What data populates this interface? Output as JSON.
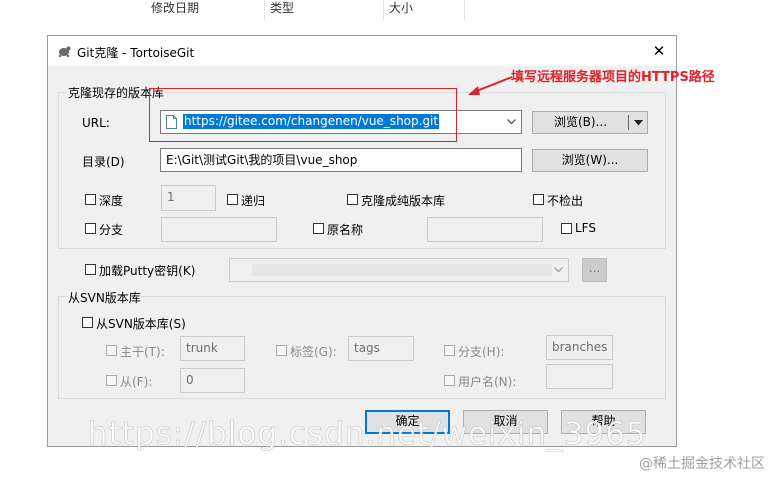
{
  "background": {
    "columns": [
      "修改日期",
      "类型",
      "大小"
    ]
  },
  "dialog": {
    "title": "Git克隆 - TortoiseGit",
    "close_glyph": "✕",
    "clone_group": {
      "legend": "克隆现存的版本库",
      "url_label": "URL:",
      "url_value": "https://gitee.com/changenen/vue_shop.git",
      "browse_button": "浏览(B)...",
      "dir_label": "目录(D)",
      "dir_value": "E:\\Git\\测试Git\\我的项目\\vue_shop",
      "browse_dir_button": "浏览(W)...",
      "depth_label": "深度",
      "depth_value": "1",
      "recursive_label": "递归",
      "bare_label": "克隆成纯版本库",
      "no_checkout_label": "不检出",
      "branch_label": "分支",
      "origin_label": "原名称",
      "lfs_label": "LFS"
    },
    "putty": {
      "label": "加载Putty密钥(K)",
      "browse": "..."
    },
    "svn_group": {
      "legend": "从SVN版本库",
      "from_svn_label": "从SVN版本库(S)",
      "trunk_label": "主干(T):",
      "trunk_value": "trunk",
      "tags_label": "标签(G):",
      "tags_value": "tags",
      "branches_label": "分支(H):",
      "branches_value": "branches",
      "from_label": "从(F):",
      "from_value": "0",
      "username_label": "用户名(N):"
    },
    "buttons": {
      "ok": "确定",
      "cancel": "取消",
      "help": "帮助"
    }
  },
  "annotation": {
    "text": "填写远程服务器项目的HTTPS路径",
    "color": "#e0212b"
  },
  "watermarks": {
    "overlay": "https://blog.csdn.net/weixin_3965",
    "footer": "@稀土掘金技术社区"
  }
}
